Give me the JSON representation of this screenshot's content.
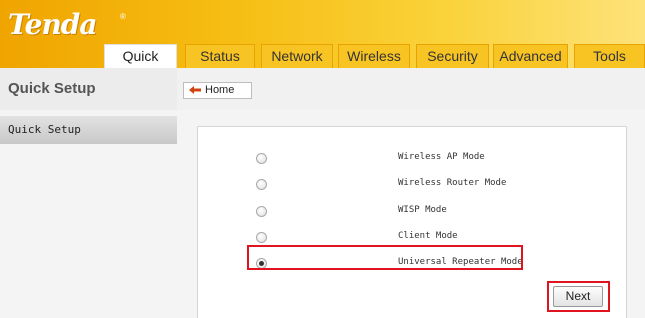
{
  "brand": {
    "logo_text": "Tenda",
    "trademark": "®"
  },
  "nav": {
    "tabs": [
      {
        "label": "Quick Setup",
        "active": true
      },
      {
        "label": "Status",
        "active": false
      },
      {
        "label": "Network",
        "active": false
      },
      {
        "label": "Wireless",
        "active": false
      },
      {
        "label": "Security",
        "active": false
      },
      {
        "label": "Advanced",
        "active": false
      },
      {
        "label": "Tools",
        "active": false
      }
    ]
  },
  "sidebar": {
    "title": "Quick Setup",
    "items": [
      {
        "label": "Quick Setup",
        "selected": true
      }
    ]
  },
  "breadcrumb": {
    "home_label": "Home",
    "icon": "home-arrow-icon"
  },
  "modes": [
    {
      "label": "Wireless AP Mode",
      "checked": false
    },
    {
      "label": "Wireless Router Mode",
      "checked": false
    },
    {
      "label": "WISP Mode",
      "checked": false
    },
    {
      "label": "Client Mode",
      "checked": false
    },
    {
      "label": "Universal Repeater Mode",
      "checked": true
    }
  ],
  "actions": {
    "next_label": "Next"
  },
  "colors": {
    "header_gradient_start": "#f0a400",
    "header_gradient_end": "#fde27a",
    "tab_bg": "#f8c423",
    "highlight": "#e0141e"
  }
}
